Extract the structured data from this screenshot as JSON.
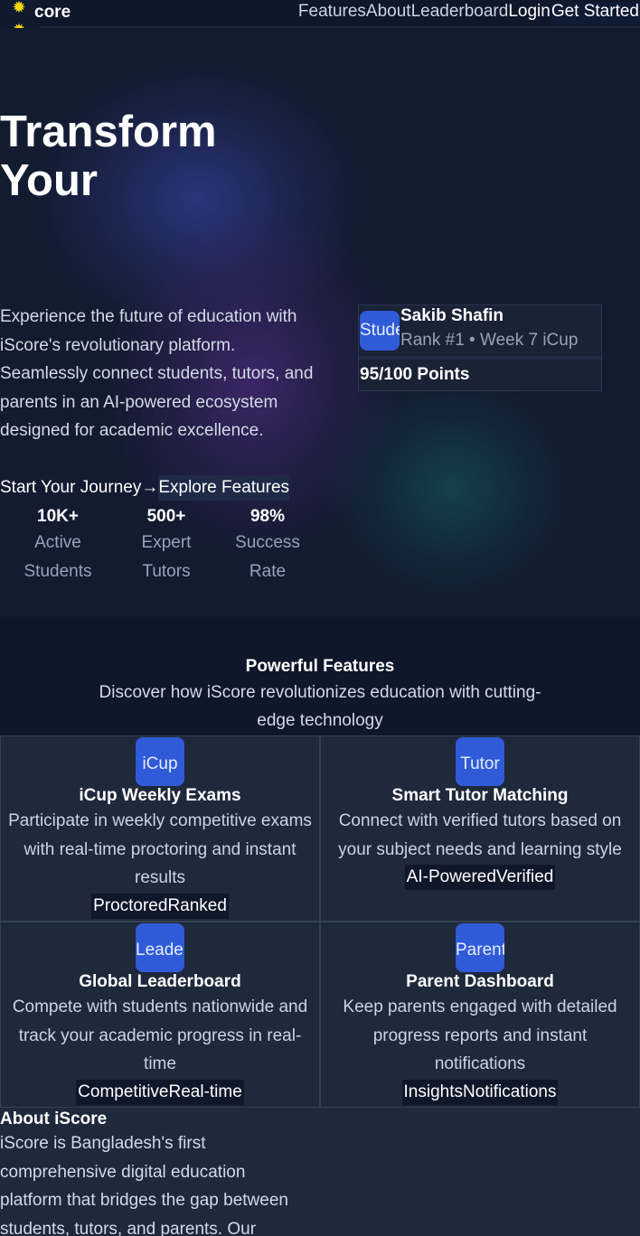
{
  "nav": {
    "brand": "iScore",
    "brand_visible": "core",
    "logo_icon": "sun-icon",
    "links": [
      "Features",
      "About",
      "Leaderboard"
    ],
    "login": "Login",
    "cta": "Get Started"
  },
  "hero": {
    "title_line1": "Transform",
    "title_line2": "Your",
    "description": "Experience the future of education with iScore's revolutionary platform. Seamlessly connect students, tutors, and parents in an AI-powered ecosystem designed for academic excellence.",
    "primary_button": "Start Your Journey",
    "primary_arrow": "→",
    "secondary_button": "Explore Features",
    "stats": [
      {
        "number": "10K+",
        "label": "Active Students"
      },
      {
        "number": "500+",
        "label": "Expert Tutors"
      },
      {
        "number": "98%",
        "label": "Success Rate"
      }
    ]
  },
  "student_card": {
    "image_alt": "Student",
    "name": "Sakib Shafin",
    "rank": "Rank #1 • Week 7 iCup",
    "points": "95/100 Points"
  },
  "features": {
    "title": "Powerful Features",
    "subtitle": "Discover how iScore revolutionizes education with cutting-edge technology",
    "items": [
      {
        "icon_alt": "iCup",
        "name": "iCup Weekly Exams",
        "description": "Participate in weekly competitive exams with real-time proctoring and instant results",
        "tags": [
          "Proctored",
          "Ranked"
        ]
      },
      {
        "icon_alt": "Tutor",
        "name": "Smart Tutor Matching",
        "description": "Connect with verified tutors based on your subject needs and learning style",
        "tags": [
          "AI-Powered",
          "Verified"
        ]
      },
      {
        "icon_alt": "Leaderboard",
        "name": "Global Leaderboard",
        "description": "Compete with students nationwide and track your academic progress in real-time",
        "tags": [
          "Competitive",
          "Real-time"
        ]
      },
      {
        "icon_alt": "Parent",
        "name": "Parent Dashboard",
        "description": "Keep parents engaged with detailed progress reports and instant notifications",
        "tags": [
          "Insights",
          "Notifications"
        ]
      }
    ]
  },
  "about": {
    "title": "About iScore",
    "text": "iScore is Bangladesh's first comprehensive digital education platform that bridges the gap between students, tutors, and parents. Our"
  },
  "colors": {
    "page_bg": "#0f172a",
    "card_bg": "#1e293b",
    "accent_blue": "#2f5bd8",
    "muted_text": "#94a3b8"
  }
}
